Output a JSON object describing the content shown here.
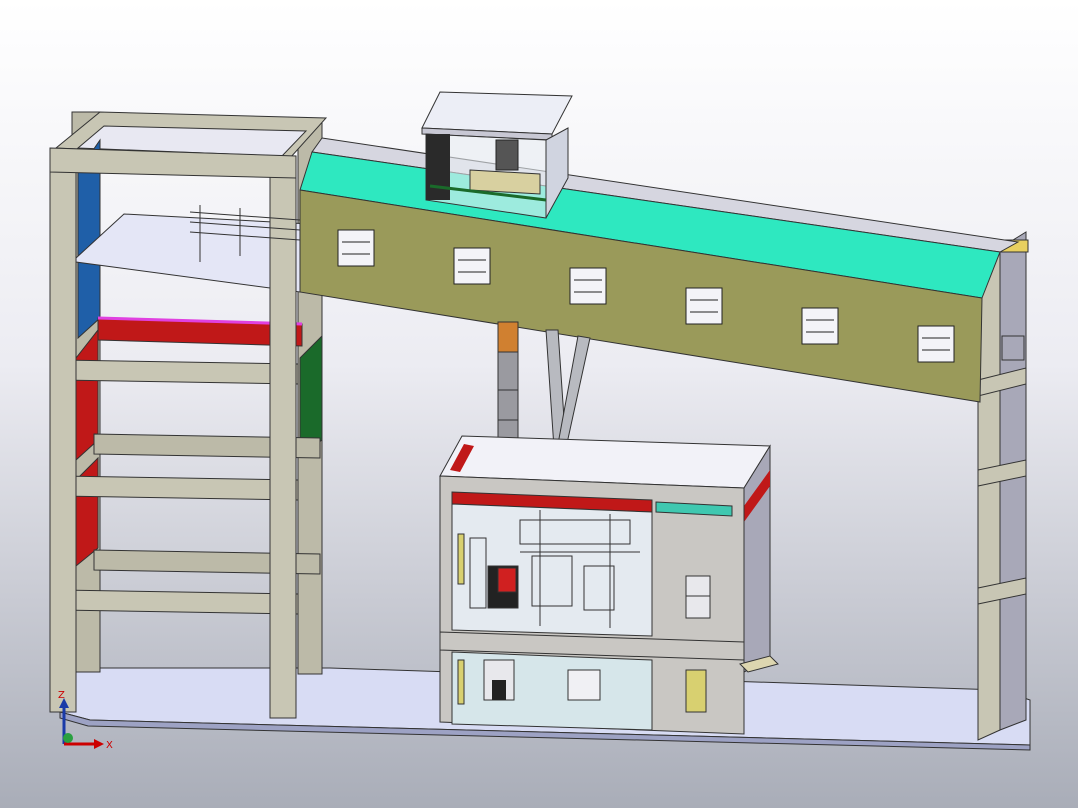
{
  "viewport": {
    "background_top": "#ffffff",
    "background_bottom": "#a9adb8"
  },
  "colors": {
    "frame": "#c8c6b4",
    "frame_dark": "#8f8d7e",
    "floor": "#d8dcf4",
    "gallery_wall": "#9a9a5a",
    "roof_band": "#2ee8c0",
    "accent_blue": "#1f5fa8",
    "accent_red": "#c01818",
    "accent_magenta": "#e040e0",
    "accent_green": "#1a6a2a",
    "building_wall": "#c9c7c3",
    "building_side": "#a8a8b8",
    "glass": "#e4eaf0",
    "annex_teal": "#3fc8b0",
    "door_yellow": "#d8d070",
    "door_orange": "#d08030"
  },
  "triad": {
    "x_label": "X",
    "z_label": "Z",
    "icon": "coordinate-triad-icon"
  }
}
